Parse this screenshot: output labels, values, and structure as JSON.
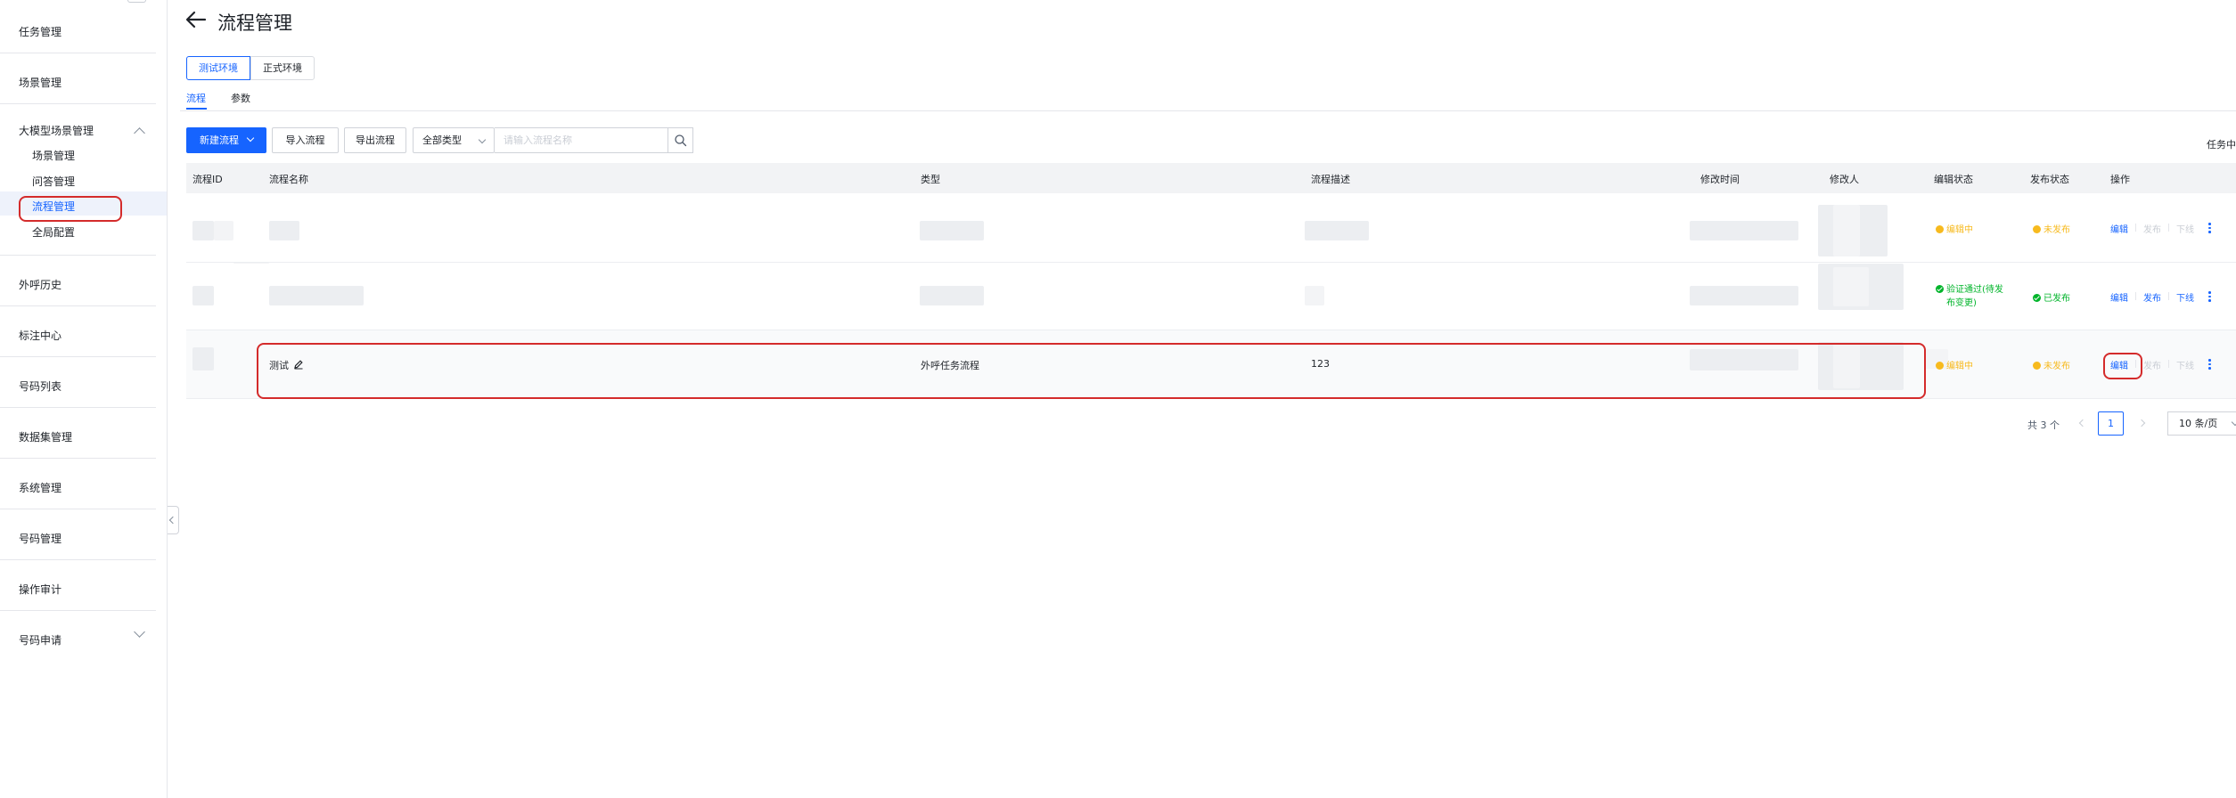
{
  "sidebar": {
    "items": [
      {
        "label": "任务管理"
      },
      {
        "label": "场景管理"
      },
      {
        "label": "大模型场景管理",
        "expanded": true,
        "children": [
          {
            "label": "场景管理"
          },
          {
            "label": "问答管理"
          },
          {
            "label": "流程管理",
            "active": true
          },
          {
            "label": "全局配置"
          }
        ]
      },
      {
        "label": "外呼历史"
      },
      {
        "label": "标注中心"
      },
      {
        "label": "号码列表"
      },
      {
        "label": "数据集管理"
      },
      {
        "label": "系统管理"
      },
      {
        "label": "号码管理"
      },
      {
        "label": "操作审计"
      },
      {
        "label": "号码申请",
        "expanded": false
      }
    ]
  },
  "header": {
    "title": "流程管理"
  },
  "env_tabs": [
    {
      "label": "测试环境",
      "active": true
    },
    {
      "label": "正式环境",
      "active": false
    }
  ],
  "sub_tabs": [
    {
      "label": "流程",
      "active": true
    },
    {
      "label": "参数",
      "active": false
    }
  ],
  "toolbar": {
    "new_label": "新建流程",
    "import_label": "导入流程",
    "export_label": "导出流程",
    "type_select_value": "全部类型",
    "search_placeholder": "请输入流程名称",
    "right_cut_text": "任务中"
  },
  "table": {
    "headers": [
      "流程ID",
      "流程名称",
      "类型",
      "流程描述",
      "修改时间",
      "修改人",
      "编辑状态",
      "发布状态",
      "操作"
    ],
    "rows": [
      {
        "name": "",
        "type": "",
        "desc": "",
        "edit_status": "编辑中",
        "edit_status_kind": "warn",
        "publish_status": "未发布",
        "publish_status_kind": "warn",
        "ops": {
          "edit": "编辑",
          "publish": "发布",
          "offline": "下线"
        },
        "ops_enabled": {
          "publish": false,
          "offline": false
        }
      },
      {
        "name": "",
        "type": "",
        "desc": "",
        "edit_status": "验证通过(待发布变更)",
        "edit_status_line1": "验证通过(待发",
        "edit_status_line2": "布变更)",
        "edit_status_kind": "ok",
        "publish_status": "已发布",
        "publish_status_kind": "ok",
        "ops": {
          "edit": "编辑",
          "publish": "发布",
          "offline": "下线"
        },
        "ops_enabled": {
          "publish": true,
          "offline": true
        }
      },
      {
        "name": "测试",
        "type": "外呼任务流程",
        "desc": "123",
        "edit_status": "编辑中",
        "edit_status_kind": "warn",
        "publish_status": "未发布",
        "publish_status_kind": "warn",
        "ops": {
          "edit": "编辑",
          "publish": "发布",
          "offline": "下线"
        },
        "ops_enabled": {
          "publish": false,
          "offline": false
        }
      }
    ]
  },
  "pagination": {
    "total_text": "共 3 个",
    "current_page": "1",
    "page_size": "10 条/页"
  },
  "colors": {
    "primary": "#1664ff",
    "warning": "#f7ba1e",
    "success": "#00b42a",
    "highlight": "#d42b2b"
  }
}
